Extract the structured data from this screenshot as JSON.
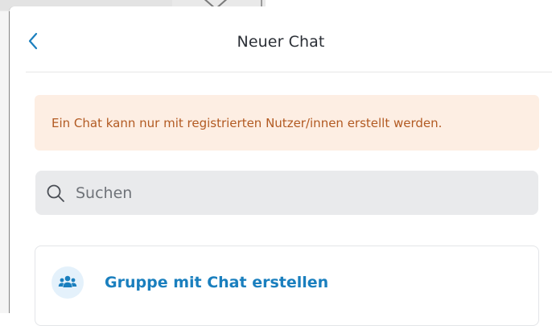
{
  "header": {
    "title": "Neuer Chat",
    "back_icon": "chevron-left-icon"
  },
  "notice": {
    "text": "Ein Chat kann nur mit registrierten Nutzer/innen erstellt werden."
  },
  "search": {
    "placeholder": "Suchen",
    "value": "",
    "icon": "search-icon"
  },
  "actions": {
    "create_group_label": "Gruppe mit Chat erstellen",
    "create_group_icon": "users-icon"
  },
  "colors": {
    "accent": "#1a7fbe",
    "notice_bg": "#fdeee3",
    "notice_text": "#b25a22",
    "search_bg": "#e9eaec"
  }
}
